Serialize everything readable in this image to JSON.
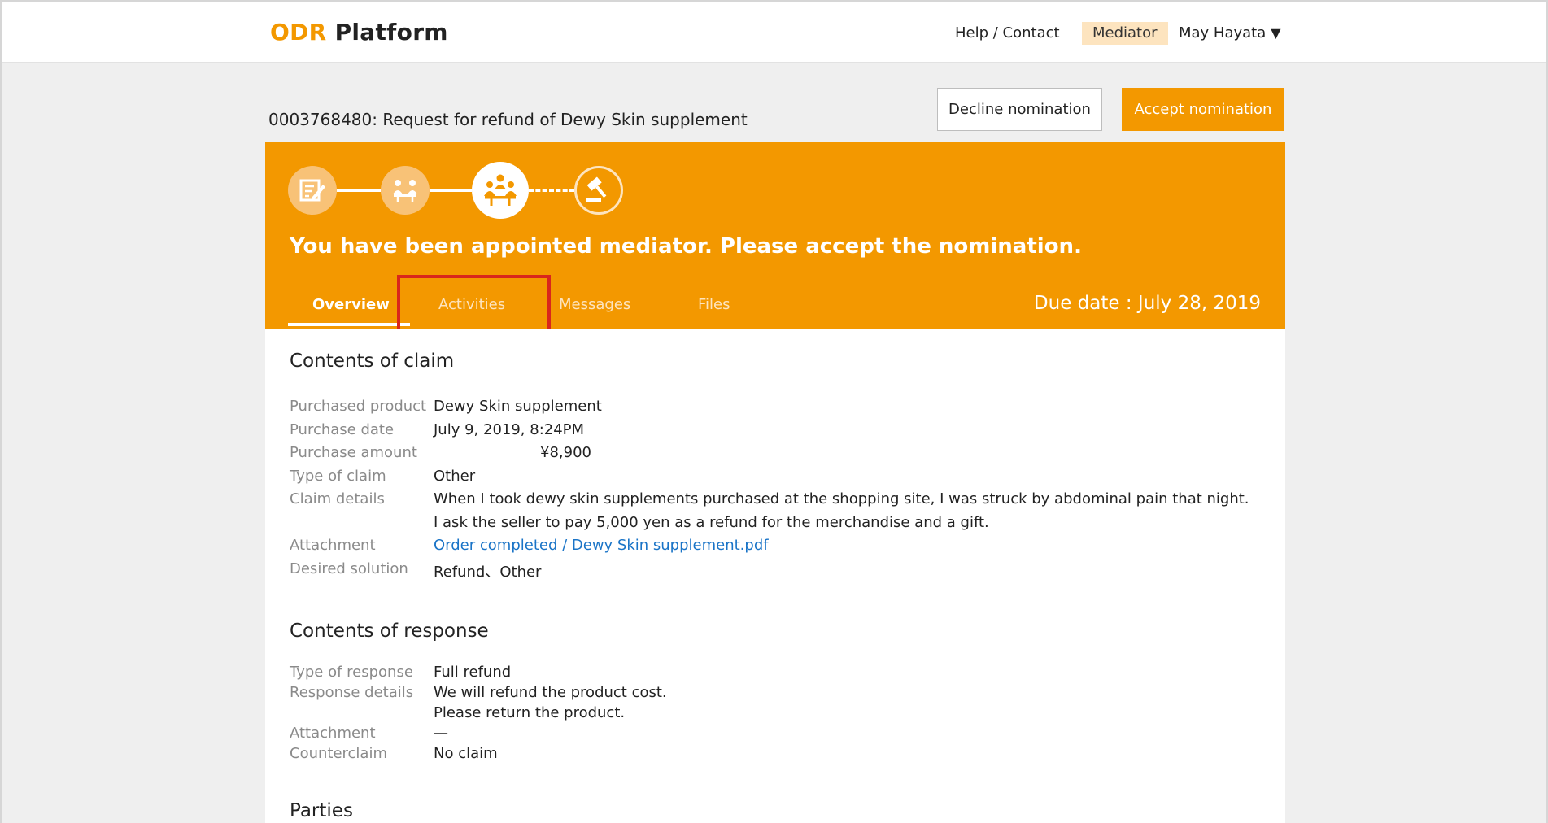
{
  "header": {
    "logo_odr": "ODR",
    "logo_platform": "Platform",
    "help": "Help / Contact",
    "role": "Mediator",
    "user": "May Hayata",
    "user_caret": "▼"
  },
  "case": {
    "title": "0003768480: Request for refund of Dewy Skin supplement",
    "decline_label": "Decline nomination",
    "accept_label": "Accept nomination"
  },
  "progress": {
    "steps": [
      "edit-claim-icon",
      "negotiation-icon",
      "mediation-icon",
      "decision-gavel-icon"
    ],
    "current_step": 3,
    "message": "You have been appointed mediator. Please accept the nomination."
  },
  "tabs": {
    "overview": "Overview",
    "activities": "Activities",
    "messages": "Messages",
    "files": "Files",
    "active": "Overview",
    "highlighted": "Activities"
  },
  "due": "Due date : July 28, 2019",
  "claim": {
    "title": "Contents of claim",
    "product_label": "Purchased product",
    "product_value": "Dewy Skin supplement",
    "date_label": "Purchase date",
    "date_value": "July 9, 2019, 8:24PM",
    "amount_label": "Purchase amount",
    "amount_value": "¥8,900",
    "type_label": "Type of claim",
    "type_value": "Other",
    "details_label": "Claim details",
    "details_line1": "When I took dewy skin supplements purchased at the shopping site, I was struck by abdominal pain that night.",
    "details_line2": "I ask the seller to pay 5,000 yen as a refund for the merchandise and a gift.",
    "attachment_label": "Attachment",
    "attachment_value": "Order completed / Dewy Skin supplement.pdf",
    "solution_label": "Desired solution",
    "solution_value": "Refund、Other"
  },
  "response": {
    "title": "Contents of response",
    "type_label": "Type of response",
    "type_value": "Full refund",
    "details_label": "Response details",
    "details_line1": "We will refund the product cost.",
    "details_line2": "Please return the product.",
    "attachment_label": "Attachment",
    "attachment_value": "—",
    "counterclaim_label": "Counterclaim",
    "counterclaim_value": "No claim"
  },
  "parties": {
    "title": "Parties"
  },
  "colors": {
    "accent": "#f39800",
    "badge": "#fde4bf",
    "link": "#1a74c7",
    "highlight": "#d9261c"
  }
}
